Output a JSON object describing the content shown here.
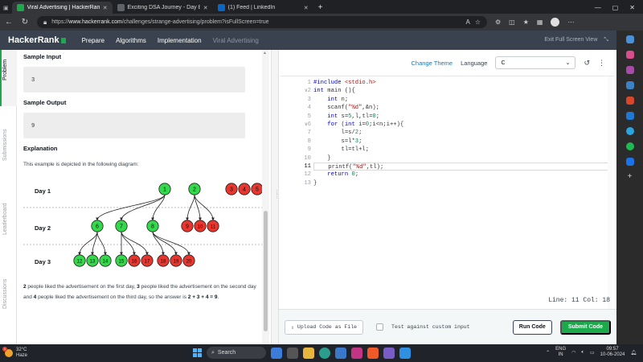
{
  "browser": {
    "tabs": [
      {
        "title": "Viral Advertising | HackerRank",
        "active": true,
        "favicon_color": "#1ba94c"
      },
      {
        "title": "Exciting DSA Journey - Day 8",
        "active": false,
        "favicon_color": "#5f6368"
      },
      {
        "title": "(1) Feed | LinkedIn",
        "active": false,
        "favicon_color": "#0a66c2"
      }
    ],
    "url_scheme": "https://",
    "url_host": "www.hackerrank.com",
    "url_path": "/challenges/strange-advertising/problem?isFullScreen=true"
  },
  "header": {
    "logo": "HackerRank",
    "nav": [
      "Prepare",
      "Algorithms",
      "Implementation",
      "Viral Advertising"
    ],
    "exit_fullscreen": "Exit Full Screen View"
  },
  "rail": [
    "Problem",
    "Submissions",
    "Leaderboard",
    "Discussions"
  ],
  "problem": {
    "sample_input_heading": "Sample Input",
    "sample_input": "3",
    "sample_output_heading": "Sample Output",
    "sample_output": "9",
    "explanation_heading": "Explanation",
    "explanation_intro": "This example is depicted in the following diagram:",
    "diagram": {
      "days": [
        "Day 1",
        "Day 2",
        "Day 3"
      ],
      "day1_liked": [
        "1",
        "2"
      ],
      "day1_other": [
        "3",
        "4",
        "5"
      ],
      "day2_liked": [
        "6",
        "7",
        "8"
      ],
      "day2_other": [
        "9",
        "10",
        "11"
      ],
      "day3_liked": [
        "12",
        "13",
        "14",
        "15"
      ],
      "day3_other": [
        "16",
        "17",
        "18",
        "19",
        "20"
      ],
      "green": "#33d94a",
      "red": "#e8352e"
    },
    "explanation": {
      "n1": "2",
      "t1": " people liked the advertisement on the first day, ",
      "n2": "3",
      "t2": " people liked the advertisement on the second day and ",
      "n3": "4",
      "t3": " people liked the advertisement on the third day, so the answer is ",
      "sum": "2 + 3 + 4 = 9",
      "end": "."
    }
  },
  "editor": {
    "change_theme": "Change Theme",
    "language_label": "Language",
    "language": "C",
    "line_numbers": [
      "1",
      "2",
      "3",
      "4",
      "5",
      "6",
      "7",
      "8",
      "9",
      "10",
      "11",
      "12",
      "13"
    ],
    "current_line": 11,
    "status": "Line: 11 Col: 18",
    "upload": "Upload Code as File",
    "custom_input": "Test against custom input",
    "run": "Run Code",
    "submit": "Submit Code"
  },
  "taskbar": {
    "temp": "32°C",
    "weather": "Haze",
    "alert": "1",
    "search": "Search",
    "lang1": "ENG",
    "lang2": "IN",
    "time": "09:57",
    "date": "10-06-2024"
  }
}
